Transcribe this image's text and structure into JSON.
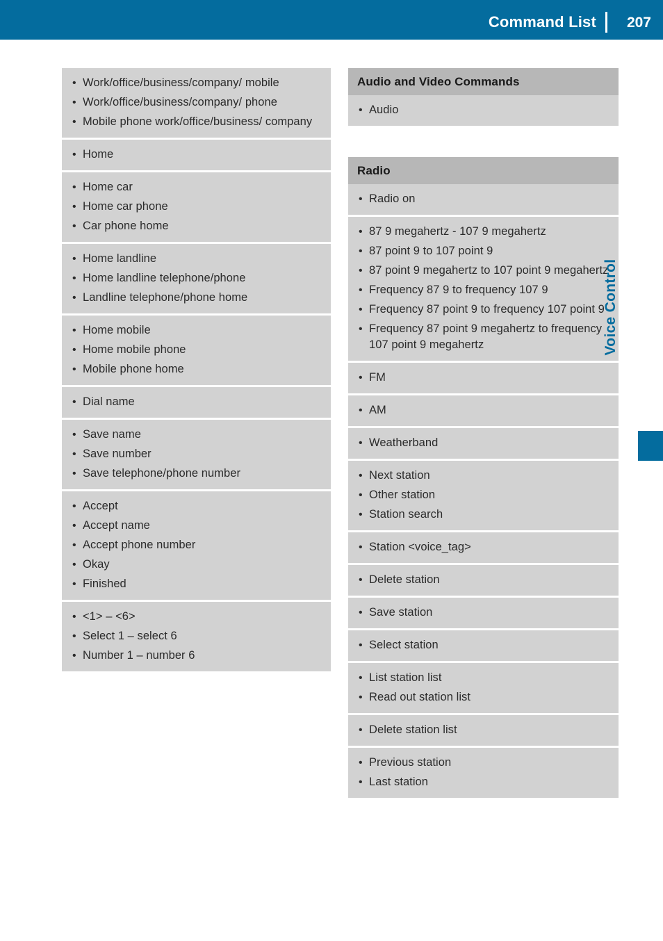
{
  "header": {
    "title": "Command List",
    "page_number": "207",
    "bar_color": "#046c9e"
  },
  "side_tab": {
    "label": "Voice Control",
    "color": "#046c9e"
  },
  "colors": {
    "section_head_bg": "#b7b7b7",
    "group_bg": "#d2d2d2",
    "text": "#2b2b2b"
  },
  "left_column": {
    "groups": [
      {
        "commands": [
          "Work/office/business/company/ mobile",
          "Work/office/business/company/ phone",
          "Mobile phone work/office/business/ company"
        ]
      },
      {
        "commands": [
          "Home"
        ]
      },
      {
        "commands": [
          "Home car",
          "Home car phone",
          "Car phone home"
        ]
      },
      {
        "commands": [
          "Home landline",
          "Home landline telephone/phone",
          "Landline telephone/phone home"
        ]
      },
      {
        "commands": [
          "Home mobile",
          "Home mobile phone",
          "Mobile phone home"
        ]
      },
      {
        "commands": [
          "Dial name"
        ]
      },
      {
        "commands": [
          "Save name",
          "Save number",
          "Save telephone/phone number"
        ]
      },
      {
        "commands": [
          "Accept",
          "Accept name",
          "Accept phone number",
          "Okay",
          "Finished"
        ]
      },
      {
        "commands": [
          "<1> – <6>",
          "Select 1 – select 6",
          "Number 1 – number 6"
        ]
      }
    ]
  },
  "right_column": {
    "sections": [
      {
        "heading": "Audio and Video Commands",
        "groups": [
          {
            "commands": [
              "Audio"
            ]
          }
        ]
      },
      {
        "heading": "Radio",
        "groups": [
          {
            "commands": [
              "Radio on"
            ]
          },
          {
            "commands": [
              "87 9 megahertz - 107 9 megahertz",
              "87 point 9 to 107 point 9",
              "87 point 9 megahertz to 107 point 9 megahertz",
              "Frequency 87 9 to frequency 107 9",
              "Frequency 87 point 9 to frequency 107 point 9",
              "Frequency 87 point 9 megahertz to frequency 107 point 9 megahertz"
            ]
          },
          {
            "commands": [
              "FM"
            ]
          },
          {
            "commands": [
              "AM"
            ]
          },
          {
            "commands": [
              "Weatherband"
            ]
          },
          {
            "commands": [
              "Next station",
              "Other station",
              "Station search"
            ]
          },
          {
            "commands": [
              "Station <voice_tag>"
            ]
          },
          {
            "commands": [
              "Delete station"
            ]
          },
          {
            "commands": [
              "Save station"
            ]
          },
          {
            "commands": [
              "Select station"
            ]
          },
          {
            "commands": [
              "List station list",
              "Read out station list"
            ]
          },
          {
            "commands": [
              "Delete station list"
            ]
          },
          {
            "commands": [
              "Previous station",
              "Last station"
            ]
          }
        ]
      }
    ]
  }
}
